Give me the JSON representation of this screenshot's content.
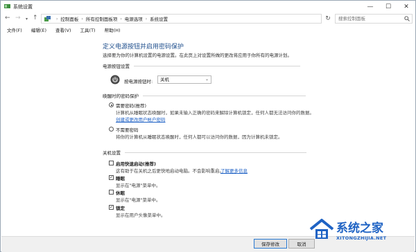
{
  "window": {
    "title": "系统设置",
    "min_glyph": "—",
    "max_glyph": "☐",
    "close_glyph": "✕"
  },
  "address": {
    "crumbs": [
      "控制面板",
      "所有控制面板项",
      "电源选项",
      "系统设置"
    ],
    "search_placeholder": "搜索控制面板"
  },
  "menu": [
    "文件(F)",
    "编辑(E)",
    "查看(V)",
    "工具(T)",
    "帮助(H)"
  ],
  "page": {
    "title": "定义电源按钮并启用密码保护",
    "description": "选择要为你的计算机设置的电源设置。在此页上对设置所做的更改将应用于你所有的电源计划。"
  },
  "power_button": {
    "section": "电源按钮设置",
    "label": "按电源按钮时:",
    "value": "关机"
  },
  "wake_password": {
    "section": "唤醒时的密码保护",
    "require": {
      "label": "需要密码(推荐)",
      "desc": "计算机从睡眠状态唤醒时，如果未输入正确的密码来解除计算机锁定，任何人都无法访问你的数据。",
      "link": "创建或更改用户帐户密码",
      "checked": true
    },
    "no_require": {
      "label": "不需要密码",
      "desc": "将你的计算机从睡眠状态唤醒时，任何人都可以访问你的数据，因为计算机未锁定。",
      "checked": false
    }
  },
  "shutdown": {
    "section": "关机设置",
    "items": [
      {
        "label": "启用快速启动(推荐)",
        "desc": "这有助于在关机之后更快地启动电脑。不会影响重启。",
        "link": "了解更多信息",
        "checked": false
      },
      {
        "label": "睡眠",
        "desc": "显示在\"电源\"菜单中。",
        "checked": true
      },
      {
        "label": "休眠",
        "desc": "显示在\"电源\"菜单中。",
        "checked": false
      },
      {
        "label": "锁定",
        "desc": "显示在用户头像菜单中。",
        "checked": true
      }
    ]
  },
  "footer": {
    "save": "保存修改",
    "cancel": "取消"
  },
  "watermark": {
    "text": "系统之家",
    "url": "XITONGZHIJIA.NET"
  },
  "colors": {
    "title_blue": "#1e4e8c",
    "link_blue": "#1a5ec4",
    "watermark_blue": "#1f63c4"
  }
}
